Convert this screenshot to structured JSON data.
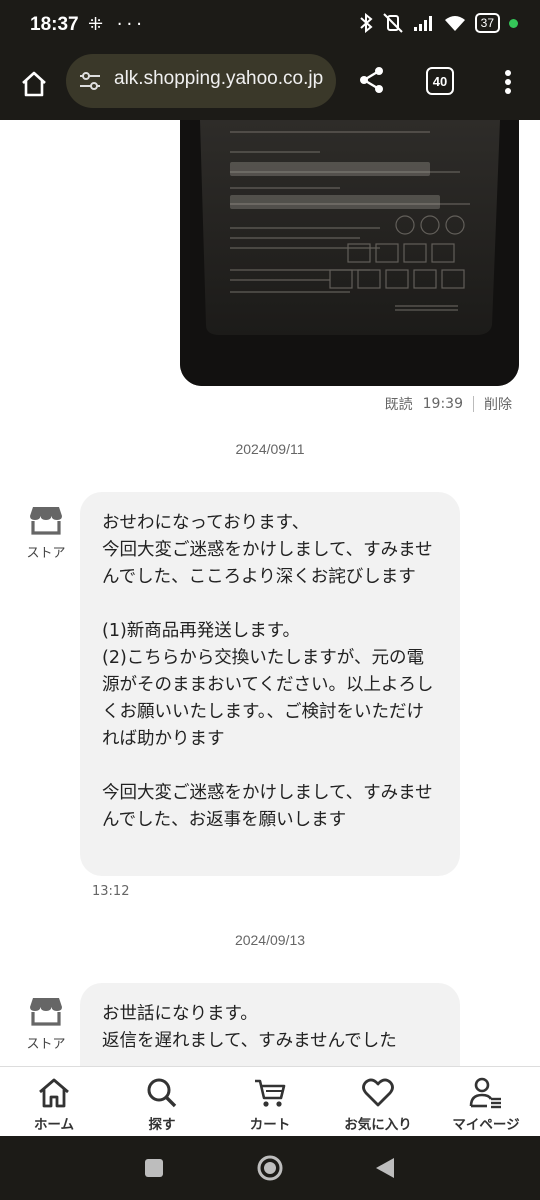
{
  "status_bar": {
    "time": "18:37",
    "left_icons": "⁜ ···",
    "battery": "37"
  },
  "browser": {
    "url": "alk.shopping.yahoo.co.jp",
    "tab_count": "40"
  },
  "thread": {
    "photo_message": {
      "read_label": "既読",
      "time": "19:39",
      "delete_label": "削除"
    },
    "date_1": "2024/09/11",
    "store_label": "ストア",
    "message_1": {
      "text": "おせわになっております、\n今回大変ご迷惑をかけしまして、すみませんでした、こころより深くお詫びします\n\n(1)新商品再発送します。\n(2)こちらから交換いたしますが、元の電源がそのままおいてください。以上よろしくお願いいたします。、ご検討をいただければ助かります\n\n今回大変ご迷惑をかけしまして、すみませんでした、お返事を願いします",
      "time": "13:12"
    },
    "date_2": "2024/09/13",
    "message_2": {
      "text": "お世話になります。\n返信を遅れまして、すみませんでした"
    }
  },
  "bottom_nav": {
    "items": [
      {
        "label": "ホーム",
        "icon": "home-icon"
      },
      {
        "label": "探す",
        "icon": "search-icon"
      },
      {
        "label": "カート",
        "icon": "cart-icon"
      },
      {
        "label": "お気に入り",
        "icon": "heart-icon"
      },
      {
        "label": "マイページ",
        "icon": "user-icon"
      }
    ]
  }
}
